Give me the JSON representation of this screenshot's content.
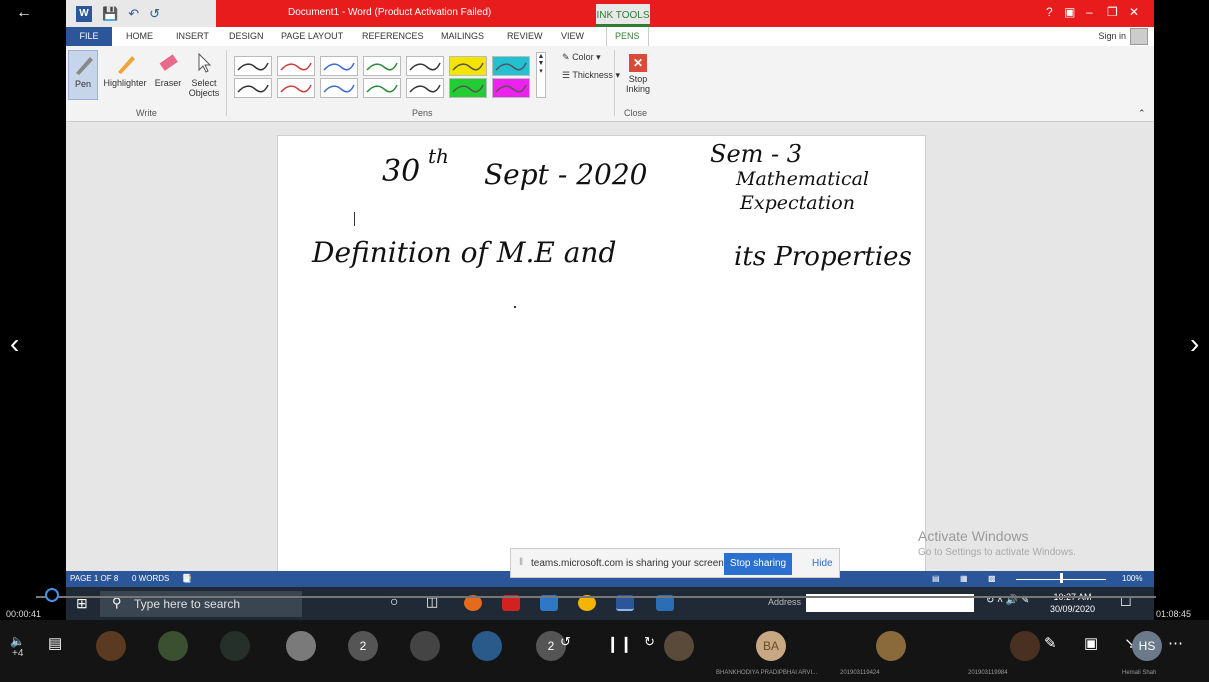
{
  "window": {
    "doc_title": "Document1 - Word (Product Activation Failed)",
    "ink_tools": "INK TOOLS",
    "help": "?",
    "sign_in": "Sign in"
  },
  "tabs": [
    "FILE",
    "HOME",
    "INSERT",
    "DESIGN",
    "PAGE LAYOUT",
    "REFERENCES",
    "MAILINGS",
    "REVIEW",
    "VIEW",
    "PENS"
  ],
  "ribbon": {
    "pen": "Pen",
    "highlighter": "Highlighter",
    "eraser": "Eraser",
    "select_objects_1": "Select",
    "select_objects_2": "Objects",
    "write_group": "Write",
    "pens_group": "Pens",
    "color": "Color",
    "thickness": "Thickness",
    "stop_inking_1": "Stop",
    "stop_inking_2": "Inking",
    "close_group": "Close"
  },
  "pen_colors": {
    "row1": [
      "#333333",
      "#d23a3a",
      "#3a6ad2",
      "#2a8a3a",
      "#333333",
      "#f5e400",
      "#22c0d0"
    ],
    "row2": [
      "#333333",
      "#d23a3a",
      "#3a6ad2",
      "#2a8a3a",
      "#333333",
      "#22cc33",
      "#ee22ee"
    ]
  },
  "document": {
    "line1_date": "30",
    "line1_sup": "th",
    "line1_rest": "Sept - 2020",
    "sem": "Sem - 3",
    "subject_1": "Mathematical",
    "subject_2": "Expectation",
    "line2": "Definition of M.E and",
    "line2_b": "its Properties"
  },
  "watermark": {
    "title": "Activate Windows",
    "sub": "Go to Settings to activate Windows."
  },
  "status": {
    "page": "PAGE 1 OF 8",
    "words": "0 WORDS",
    "zoom": "100%"
  },
  "share": {
    "text": "teams.microsoft.com is sharing your screen.",
    "stop": "Stop sharing",
    "hide": "Hide"
  },
  "taskbar": {
    "search_placeholder": "Type here to search",
    "address": "Address",
    "time": "10:27 AM",
    "date": "30/09/2020"
  },
  "player": {
    "elapsed": "00:00:41",
    "total": "01:08:45",
    "progress": 0.01
  },
  "participants": {
    "extra_count": "+4",
    "count_a": "2",
    "count_b": "2",
    "ba": "BA",
    "hs": "HS",
    "names": [
      "BHANKHODIYA PRADIPBHAI ARVI...",
      "201903119424",
      "201903119984",
      "Hemali Shah"
    ]
  }
}
